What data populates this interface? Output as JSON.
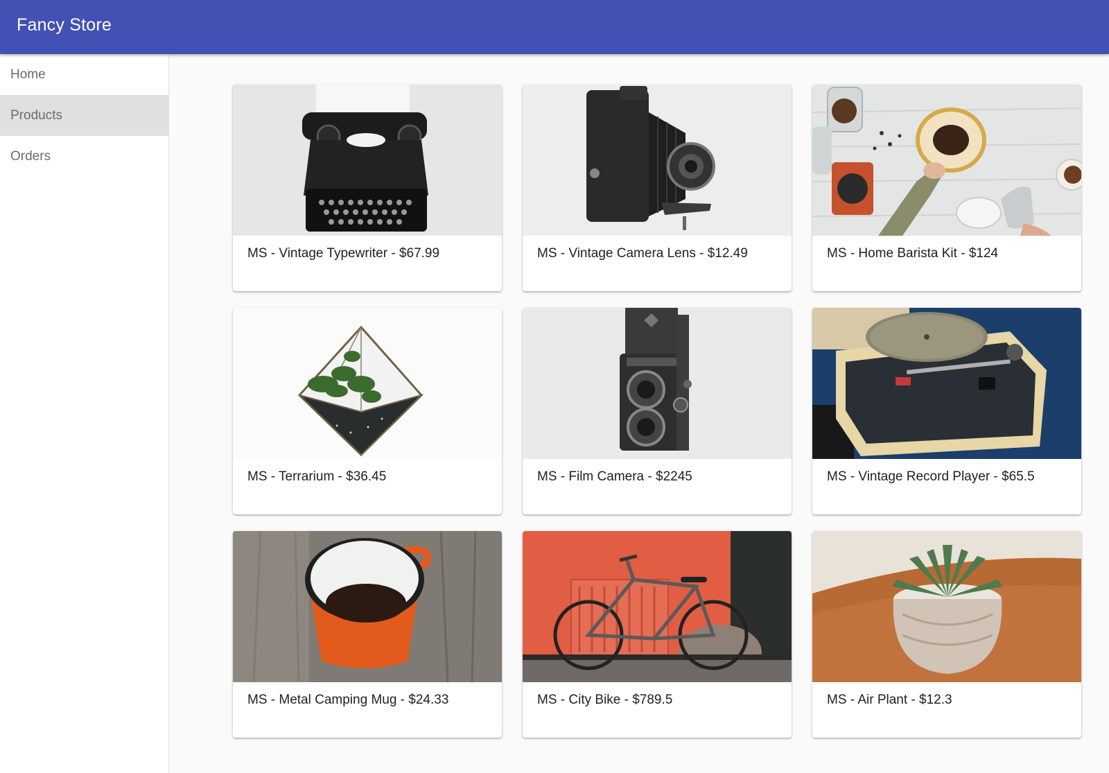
{
  "app": {
    "title": "Fancy Store"
  },
  "nav": {
    "items": [
      {
        "label": "Home",
        "active": false
      },
      {
        "label": "Products",
        "active": true
      },
      {
        "label": "Orders",
        "active": false
      }
    ]
  },
  "products": [
    {
      "label": "MS - Vintage Typewriter - $67.99",
      "image": "typewriter"
    },
    {
      "label": "MS - Vintage Camera Lens - $12.49",
      "image": "folding-camera"
    },
    {
      "label": "MS - Home Barista Kit - $124",
      "image": "coffee-pour-over"
    },
    {
      "label": "MS - Terrarium - $36.45",
      "image": "geometric-terrarium"
    },
    {
      "label": "MS - Film Camera - $2245",
      "image": "twin-lens-camera"
    },
    {
      "label": "MS - Vintage Record Player - $65.5",
      "image": "record-player"
    },
    {
      "label": "MS - Metal Camping Mug - $24.33",
      "image": "enamel-mug"
    },
    {
      "label": "MS - City Bike - $789.5",
      "image": "city-bike"
    },
    {
      "label": "MS - Air Plant - $12.3",
      "image": "succulent-pot"
    }
  ],
  "colors": {
    "appbar": "#4351b5",
    "active_nav": "#e0e0e0",
    "background": "#fafafa"
  }
}
